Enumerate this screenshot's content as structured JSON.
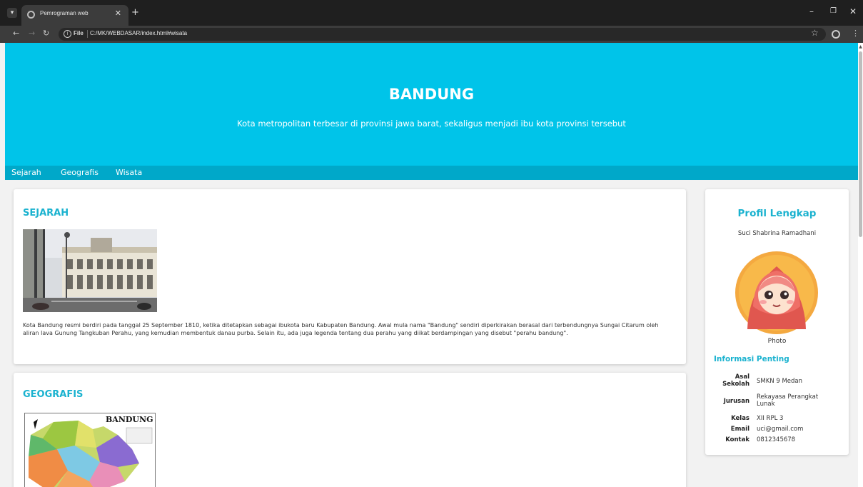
{
  "browser": {
    "tab_title": "Pemrograman web",
    "url_scheme": "File",
    "url": "C:/MK/WEBDASAR/index.html#wisata"
  },
  "hero": {
    "title": "BANDUNG",
    "subtitle": "Kota metropolitan terbesar di provinsi jawa barat, sekaligus menjadi ibu kota provinsi tersebut"
  },
  "menu": {
    "items": [
      "Sejarah",
      "Geografis",
      "Wisata"
    ]
  },
  "sejarah": {
    "title": "SEJARAH",
    "paragraph": "Kota Bandung resmi berdiri pada tanggal 25 September 1810, ketika ditetapkan sebagai ibukota baru Kabupaten Bandung. Awal mula nama \"Bandung\" sendiri diperkirakan berasal dari terbendungnya Sungai Citarum oleh aliran lava Gunung Tangkuban Perahu, yang kemudian membentuk danau purba. Selain itu, ada juga legenda tentang dua perahu yang diikat berdampingan yang disebut \"perahu bandung\"."
  },
  "geografis": {
    "title": "GEOGRAFIS",
    "map_label": "BANDUNG"
  },
  "profil": {
    "title": "Profil Lengkap",
    "name": "Suci Shabrina Ramadhani",
    "photo_caption": "Photo",
    "info_title": "Informasi Penting",
    "rows": [
      {
        "key_line1": "Asal",
        "key_line2": "Sekolah",
        "value": "SMKN 9 Medan"
      },
      {
        "key": "Jurusan",
        "value_line1": "Rekayasa Perangkat",
        "value_line2": "Lunak"
      },
      {
        "key": "Kelas",
        "value": "XII RPL 3"
      },
      {
        "key": "Email",
        "value": "uci@gmail.com"
      },
      {
        "key": "Kontak",
        "value": "0812345678"
      }
    ]
  },
  "colors": {
    "hero_bg": "#00c4e9",
    "menu_bg": "#00a8c9",
    "accent": "#1ab2cf"
  }
}
